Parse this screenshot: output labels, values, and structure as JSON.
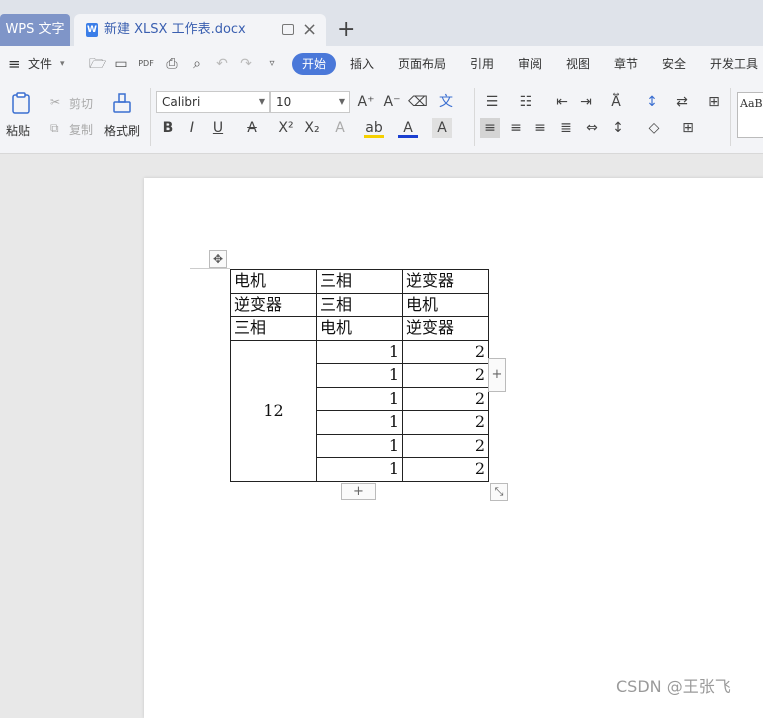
{
  "tabs": {
    "app": "WPS 文字",
    "doc_icon": "W",
    "doc_title": "新建 XLSX 工作表.docx",
    "new_tab": "+"
  },
  "menu": {
    "hamburger": "≡",
    "file": "文件",
    "items": [
      "开始",
      "插入",
      "页面布局",
      "引用",
      "审阅",
      "视图",
      "章节",
      "安全",
      "开发工具"
    ]
  },
  "ribbon": {
    "paste": "粘贴",
    "cut": "剪切",
    "copy": "复制",
    "format_painter": "格式刷",
    "font_name": "Calibri",
    "font_size": "10",
    "style_preview": "AaBb"
  },
  "table": {
    "rows": [
      [
        "电机",
        "三相",
        "逆变器"
      ],
      [
        "逆变器",
        "三相",
        "电机"
      ],
      [
        "三相",
        "电机",
        "逆变器"
      ]
    ],
    "merged_value": "12",
    "numeric_rows": [
      [
        "1",
        "2"
      ],
      [
        "1",
        "2"
      ],
      [
        "1",
        "2"
      ],
      [
        "1",
        "2"
      ],
      [
        "1",
        "2"
      ],
      [
        "1",
        "2"
      ]
    ]
  },
  "watermark": "CSDN @王张飞"
}
